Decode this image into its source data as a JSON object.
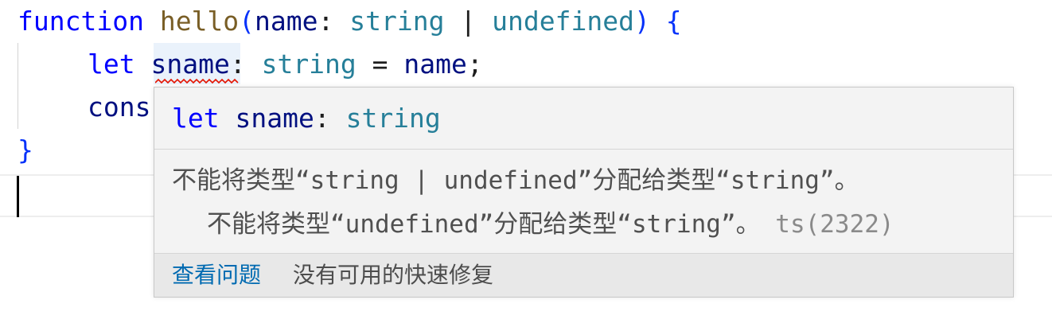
{
  "editor": {
    "line1": {
      "keyword": "function",
      "name": "hello",
      "paren_open": "(",
      "param": "name",
      "colon": ":",
      "type1": "string",
      "pipe": "|",
      "type2": "undefined",
      "paren_close": ")",
      "brace": "{"
    },
    "line2": {
      "keyword": "let",
      "var": "sname",
      "colon": ":",
      "type": "string",
      "eq": "=",
      "value": "name",
      "semi": ";"
    },
    "line3": {
      "partial": "cons"
    },
    "line4": {
      "brace": "}"
    }
  },
  "hover": {
    "signature": {
      "keyword": "let",
      "name": "sname",
      "colon": ":",
      "type": "string"
    },
    "message_line1": "不能将类型“string | undefined”分配给类型“string”。",
    "message_line2": "不能将类型“undefined”分配给类型“string”。",
    "error_code": "ts(2322)",
    "actions": {
      "view_problem": "查看问题",
      "no_quick_fix": "没有可用的快速修复"
    }
  },
  "colors": {
    "keyword": "#0000ff",
    "function": "#795e26",
    "identifier": "#001080",
    "type": "#267f99",
    "error_squiggle": "#e51400",
    "link": "#006ab1"
  }
}
